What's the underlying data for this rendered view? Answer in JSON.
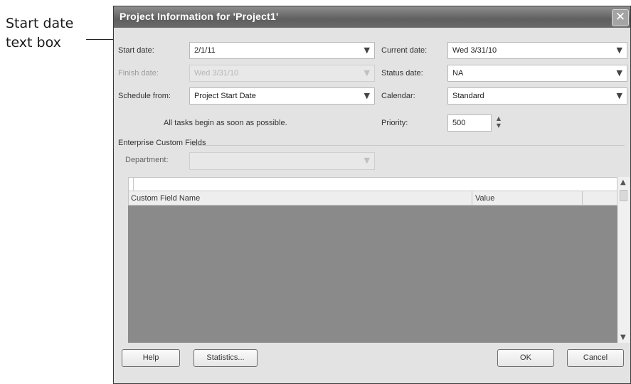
{
  "callout": {
    "line1": "Start date",
    "line2": "text box"
  },
  "dialog": {
    "title": "Project Information for 'Project1'",
    "close_glyph": "✕"
  },
  "fields": {
    "start_date": {
      "label": "Start date:",
      "value": "2/1/11"
    },
    "finish_date": {
      "label": "Finish date:",
      "value": "Wed 3/31/10",
      "disabled": true
    },
    "schedule_from": {
      "label": "Schedule from:",
      "value": "Project Start Date"
    },
    "schedule_note": "All tasks begin as soon as possible.",
    "current_date": {
      "label": "Current date:",
      "value": "Wed 3/31/10"
    },
    "status_date": {
      "label": "Status date:",
      "value": "NA"
    },
    "calendar": {
      "label": "Calendar:",
      "value": "Standard"
    },
    "priority": {
      "label": "Priority:",
      "value": "500"
    }
  },
  "enterprise": {
    "group_label": "Enterprise Custom Fields",
    "department": {
      "label": "Department:",
      "value": "",
      "disabled": true
    }
  },
  "grid": {
    "columns": [
      "Custom Field Name",
      "Value"
    ]
  },
  "buttons": {
    "help": "Help",
    "statistics": "Statistics...",
    "ok": "OK",
    "cancel": "Cancel"
  },
  "icons": {
    "dropdown": "chevron-down-icon",
    "close": "close-icon",
    "spinner": "spinner-icon"
  }
}
